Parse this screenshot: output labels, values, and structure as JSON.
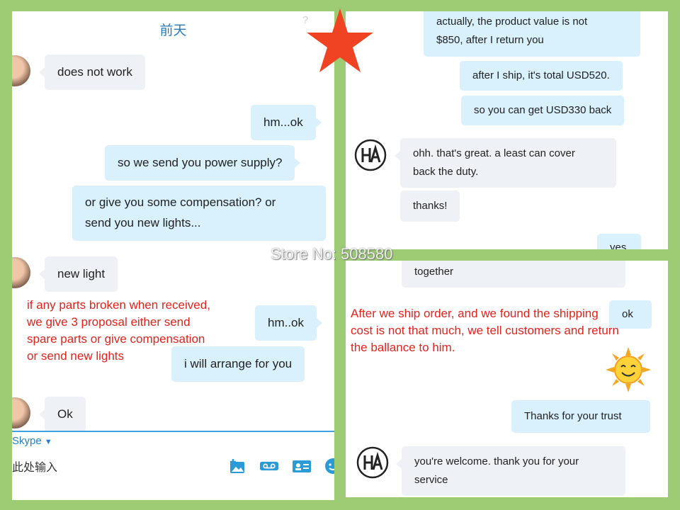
{
  "left_chat": {
    "title": "前天",
    "help": "?",
    "messages": [
      {
        "text": "does not work"
      },
      {
        "text": "hm...ok"
      },
      {
        "text": "so we send you power supply?"
      },
      {
        "line1": "or give you some compensation? or",
        "line2": "send you new lights..."
      },
      {
        "text": "new light"
      },
      {
        "text": "hm..ok"
      },
      {
        "text": "i will arrange for you"
      },
      {
        "text": "Ok"
      }
    ],
    "composer": {
      "network": "Skype",
      "placeholder": "此处输入"
    }
  },
  "top_right_chat": {
    "messages": [
      {
        "line1": "actually, the product value is not",
        "line2": "$850, after I return you"
      },
      {
        "text": "after I ship, it's total USD520."
      },
      {
        "text": "so you can get USD330 back"
      },
      {
        "line1": "ohh. that's great. a least can cover",
        "line2": "back the duty."
      },
      {
        "text": "thanks!"
      },
      {
        "text": "yes"
      }
    ]
  },
  "bottom_right_chat": {
    "messages": [
      {
        "text": "together"
      },
      {
        "text": "ok"
      },
      {
        "text": "Thanks for your trust"
      },
      {
        "line1": "you're welcome. thank you for your",
        "line2": "service"
      }
    ]
  },
  "annotations": {
    "left": [
      "if any parts broken when received,",
      "we give 3 proposal either send",
      "spare parts or give compensation",
      "or send new lights"
    ],
    "right": [
      "After we ship order, and we found the shipping",
      "cost is not that much, we tell customers and return",
      "the ballance to him."
    ]
  },
  "watermark": "Store No: 508580",
  "icons": {
    "star": "star-icon",
    "sun": "smiling-sun-icon"
  },
  "colors": {
    "background": "#9dcc74",
    "outgoing_bubble": "#d8f1fd",
    "incoming_bubble": "#eef1f5",
    "annotation": "#e4231b",
    "skype_blue": "#2780c6"
  }
}
